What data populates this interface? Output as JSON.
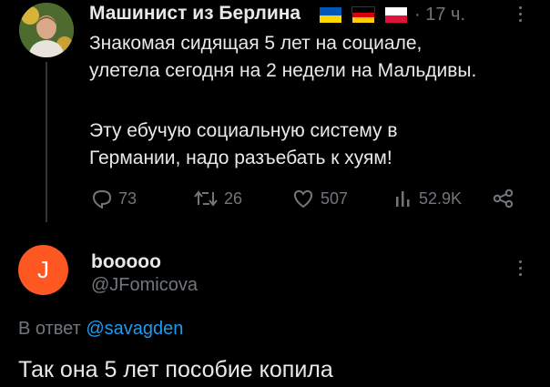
{
  "tweet": {
    "author_name": "Машинист из Берлина",
    "flags": [
      "ukraine-flag",
      "germany-flag",
      "poland-flag"
    ],
    "time": "· 17 ч.",
    "text_lines": [
      "Знакомая сидящая 5 лет на социале,",
      "улетела сегодня на 2 недели на Мальдивы.",
      "",
      "Эту ебучую социальную систему в",
      "Германии, надо разъебать к хуям!"
    ],
    "stats": {
      "replies": "73",
      "retweets": "26",
      "likes": "507",
      "views": "52.9K"
    }
  },
  "reply": {
    "avatar_letter": "J",
    "avatar_color": "#ff5722",
    "author_name": "booooo",
    "handle": "@JFomicova",
    "reply_to_prefix": "В ответ",
    "reply_to_mention": "@savagden",
    "text": "Так она 5 лет пособие копила"
  },
  "colors": {
    "background": "#000000",
    "text": "#e7e9ea",
    "secondary": "#71767b",
    "link": "#1d9bf0"
  }
}
